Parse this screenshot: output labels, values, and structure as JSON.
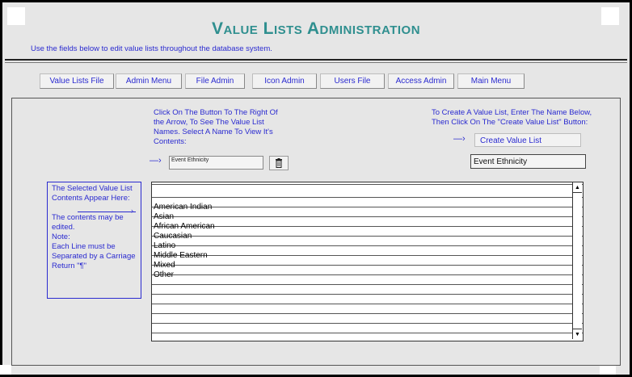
{
  "header": {
    "title": "Value Lists Administration",
    "subtitle": "Use the fields below to edit value lists throughout the database system."
  },
  "nav": {
    "items": [
      {
        "label": "Value Lists File"
      },
      {
        "label": "Admin Menu"
      },
      {
        "label": "File Admin"
      },
      {
        "label": "Icon Admin"
      },
      {
        "label": "Users File"
      },
      {
        "label": "Access Admin"
      },
      {
        "label": "Main Menu"
      }
    ]
  },
  "instructions": {
    "left": [
      "Click On The Button To The Right Of",
      "the Arrow, To See The Value List",
      "Names.  Select A Name To View It's",
      "Contents:"
    ],
    "right": [
      "To Create A Value List, Enter The Name Below,",
      "Then Click On The \"Create Value List\" Button:"
    ]
  },
  "selector": {
    "value": "Event Ethnicity"
  },
  "create": {
    "button_label": "Create Value List",
    "name_value": "Event Ethnicity"
  },
  "side_note": {
    "lines": [
      "The Selected Value List",
      "Contents Appear Here:",
      "",
      "The contents may be",
      "edited.",
      "Note:",
      "Each Line must be",
      "Separated by a Carriage",
      "Return \"¶\""
    ]
  },
  "list": {
    "items": [
      "",
      "American Indian",
      "Asian",
      "African American",
      "Caucasian",
      "Latino",
      "Middle Eastern",
      "Mixed",
      "Other"
    ]
  },
  "icons": {
    "trash": "trash-icon",
    "arrow": "arrow-right-icon",
    "scroll_up": "scroll-up-icon",
    "scroll_down": "scroll-down-icon"
  },
  "colors": {
    "title": "#2f8f8f",
    "text": "#2a2ad0",
    "background": "#e6e6e6"
  }
}
